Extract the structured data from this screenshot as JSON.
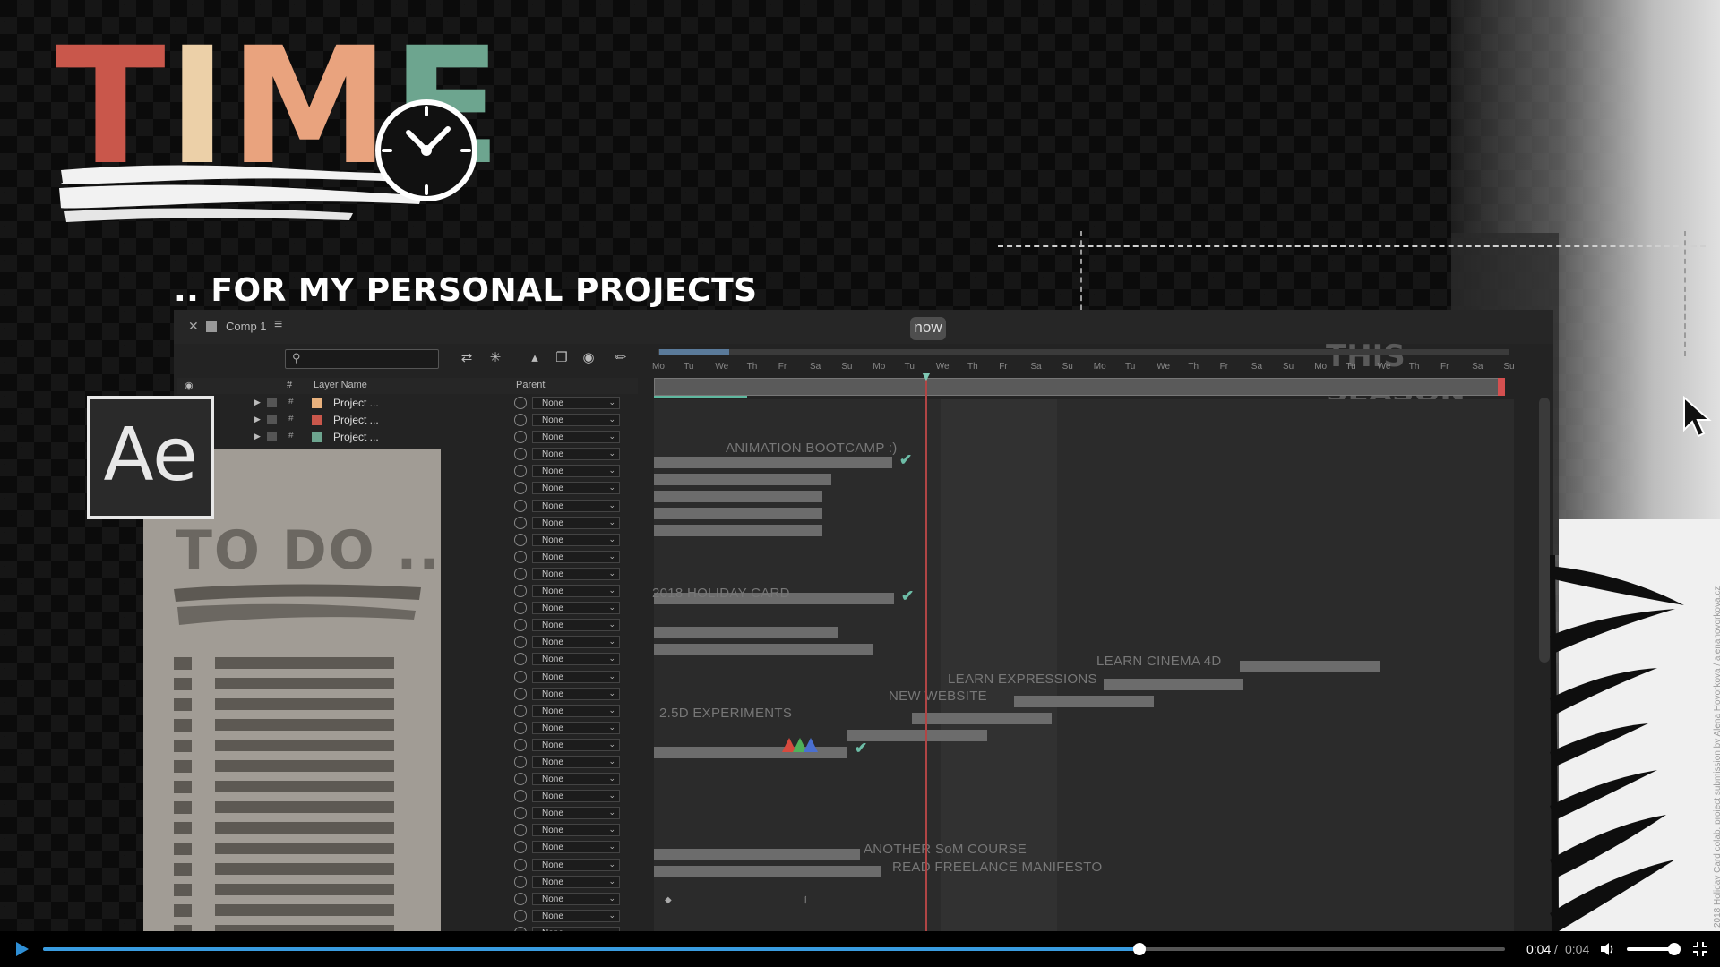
{
  "title": {
    "letters": [
      "T",
      "I",
      "M",
      "E"
    ],
    "colors": [
      "#c9574b",
      "#ecd0a8",
      "#e9a37e",
      "#6da58f"
    ]
  },
  "subtitle": ".. FOR MY PERSONAL PROJECTS",
  "ae_logo": "Ae",
  "todo": {
    "title": "TO DO .."
  },
  "panel": {
    "tab_close": "✕",
    "comp_name": "Comp 1",
    "tab_menu": "≡",
    "columns": {
      "eye": "◉",
      "hash": "#",
      "layer_name": "Layer Name",
      "parent": "Parent"
    },
    "parent_value": "None",
    "layer_rows": [
      {
        "name": "Project ...",
        "label_color": "#e9b27e"
      },
      {
        "name": "Project ...",
        "label_color": "#c9574b"
      },
      {
        "name": "Project ...",
        "label_color": "#6da58f"
      }
    ]
  },
  "timeline": {
    "season_label": "THIS SEASON",
    "now_label": "now",
    "days": [
      "Mo",
      "Tu",
      "We",
      "Th",
      "Fr",
      "Sa",
      "Su",
      "Mo",
      "Tu",
      "We",
      "Th",
      "Fr",
      "Sa",
      "Su",
      "Mo",
      "Tu",
      "We",
      "Th",
      "Fr",
      "Sa",
      "Su",
      "Mo",
      "Tu",
      "We",
      "Th",
      "Fr",
      "Sa",
      "Su"
    ],
    "labels": [
      "ANIMATION BOOTCAMP :)",
      "2018 HOLIDAY CARD",
      "LEARN CINEMA 4D",
      "LEARN EXPRESSIONS",
      "NEW WEBSITE",
      "2.5D EXPERIMENTS",
      "ANOTHER SoM COURSE",
      "READ FREELANCE MANIFESTO"
    ],
    "check": "✔"
  },
  "watermark": "2018 Holiday Card colab. project submission by Alena Hovorkova / alenahovorkova.cz",
  "player": {
    "current_time": "0:04",
    "separator": "/",
    "duration": "0:04",
    "progress": 0.75,
    "volume": 0.85
  }
}
